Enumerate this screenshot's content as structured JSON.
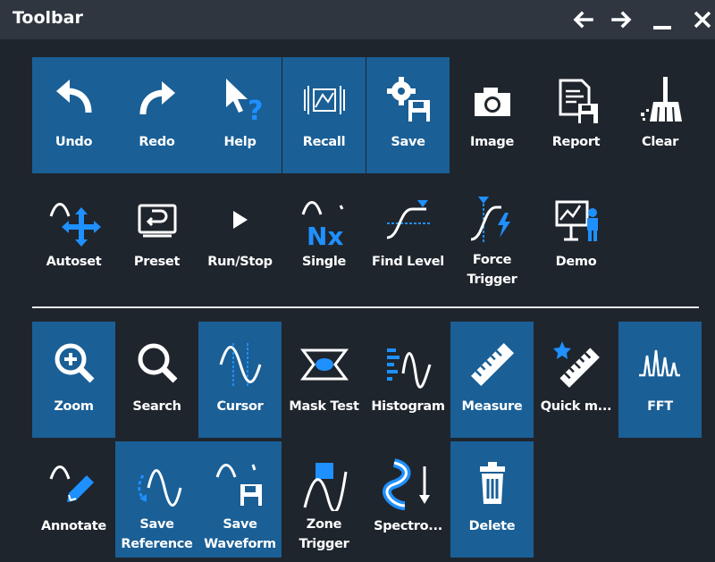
{
  "window": {
    "title": "Toolbar",
    "controls": [
      "arrow-left-icon",
      "arrow-right-icon",
      "minimize-icon",
      "close-icon"
    ]
  },
  "colors": {
    "background": "#1f252d",
    "titlebar": "#2f3640",
    "highlight": "#1a5f96",
    "accent": "#1e90ff",
    "icon": "#ffffff"
  },
  "toolbar": {
    "row1": [
      {
        "label": "Undo",
        "icon": "undo-icon",
        "highlighted": true
      },
      {
        "label": "Redo",
        "icon": "redo-icon",
        "highlighted": true
      },
      {
        "label": "Help",
        "icon": "help-icon",
        "highlighted": true
      },
      {
        "label": "Recall",
        "icon": "recall-icon",
        "highlighted": true
      },
      {
        "label": "Save",
        "icon": "save-icon",
        "highlighted": true
      },
      {
        "label": "Image",
        "icon": "camera-icon",
        "highlighted": false
      },
      {
        "label": "Report",
        "icon": "report-icon",
        "highlighted": false
      },
      {
        "label": "Clear",
        "icon": "clear-broom-icon",
        "highlighted": false
      }
    ],
    "row2": [
      {
        "label": "Autoset",
        "icon": "autoset-icon",
        "highlighted": false
      },
      {
        "label": "Preset",
        "icon": "preset-icon",
        "highlighted": false
      },
      {
        "label": "Run/Stop",
        "icon": "play-icon",
        "highlighted": false
      },
      {
        "label": "Single",
        "icon": "single-nx-icon",
        "highlighted": false
      },
      {
        "label": "Find Level",
        "icon": "find-level-icon",
        "highlighted": false
      },
      {
        "label": "Force",
        "label2": "Trigger",
        "icon": "force-trigger-icon",
        "highlighted": false
      },
      {
        "label": "Demo",
        "icon": "demo-presenter-icon",
        "highlighted": false
      }
    ],
    "row3": [
      {
        "label": "Zoom",
        "icon": "zoom-in-icon",
        "highlighted": true
      },
      {
        "label": "Search",
        "icon": "search-icon",
        "highlighted": false
      },
      {
        "label": "Cursor",
        "icon": "cursor-icon",
        "highlighted": true
      },
      {
        "label": "Mask Test",
        "icon": "mask-test-icon",
        "highlighted": false
      },
      {
        "label": "Histogram",
        "icon": "histogram-icon",
        "highlighted": false
      },
      {
        "label": "Measure",
        "icon": "measure-ruler-icon",
        "highlighted": true
      },
      {
        "label": "Quick m...",
        "icon": "quick-measure-icon",
        "highlighted": false
      },
      {
        "label": "FFT",
        "icon": "fft-icon",
        "highlighted": true
      }
    ],
    "row4": [
      {
        "label": "Annotate",
        "icon": "annotate-pen-icon",
        "highlighted": false
      },
      {
        "label": "Save",
        "label2": "Reference",
        "icon": "save-reference-icon",
        "highlighted": true
      },
      {
        "label": "Save",
        "label2": "Waveform",
        "icon": "save-waveform-icon",
        "highlighted": true
      },
      {
        "label": "Zone",
        "label2": "Trigger",
        "icon": "zone-trigger-icon",
        "highlighted": false
      },
      {
        "label": "Spectro...",
        "icon": "spectrogram-icon",
        "highlighted": false
      },
      {
        "label": "Delete",
        "icon": "trash-icon",
        "highlighted": true
      }
    ]
  }
}
